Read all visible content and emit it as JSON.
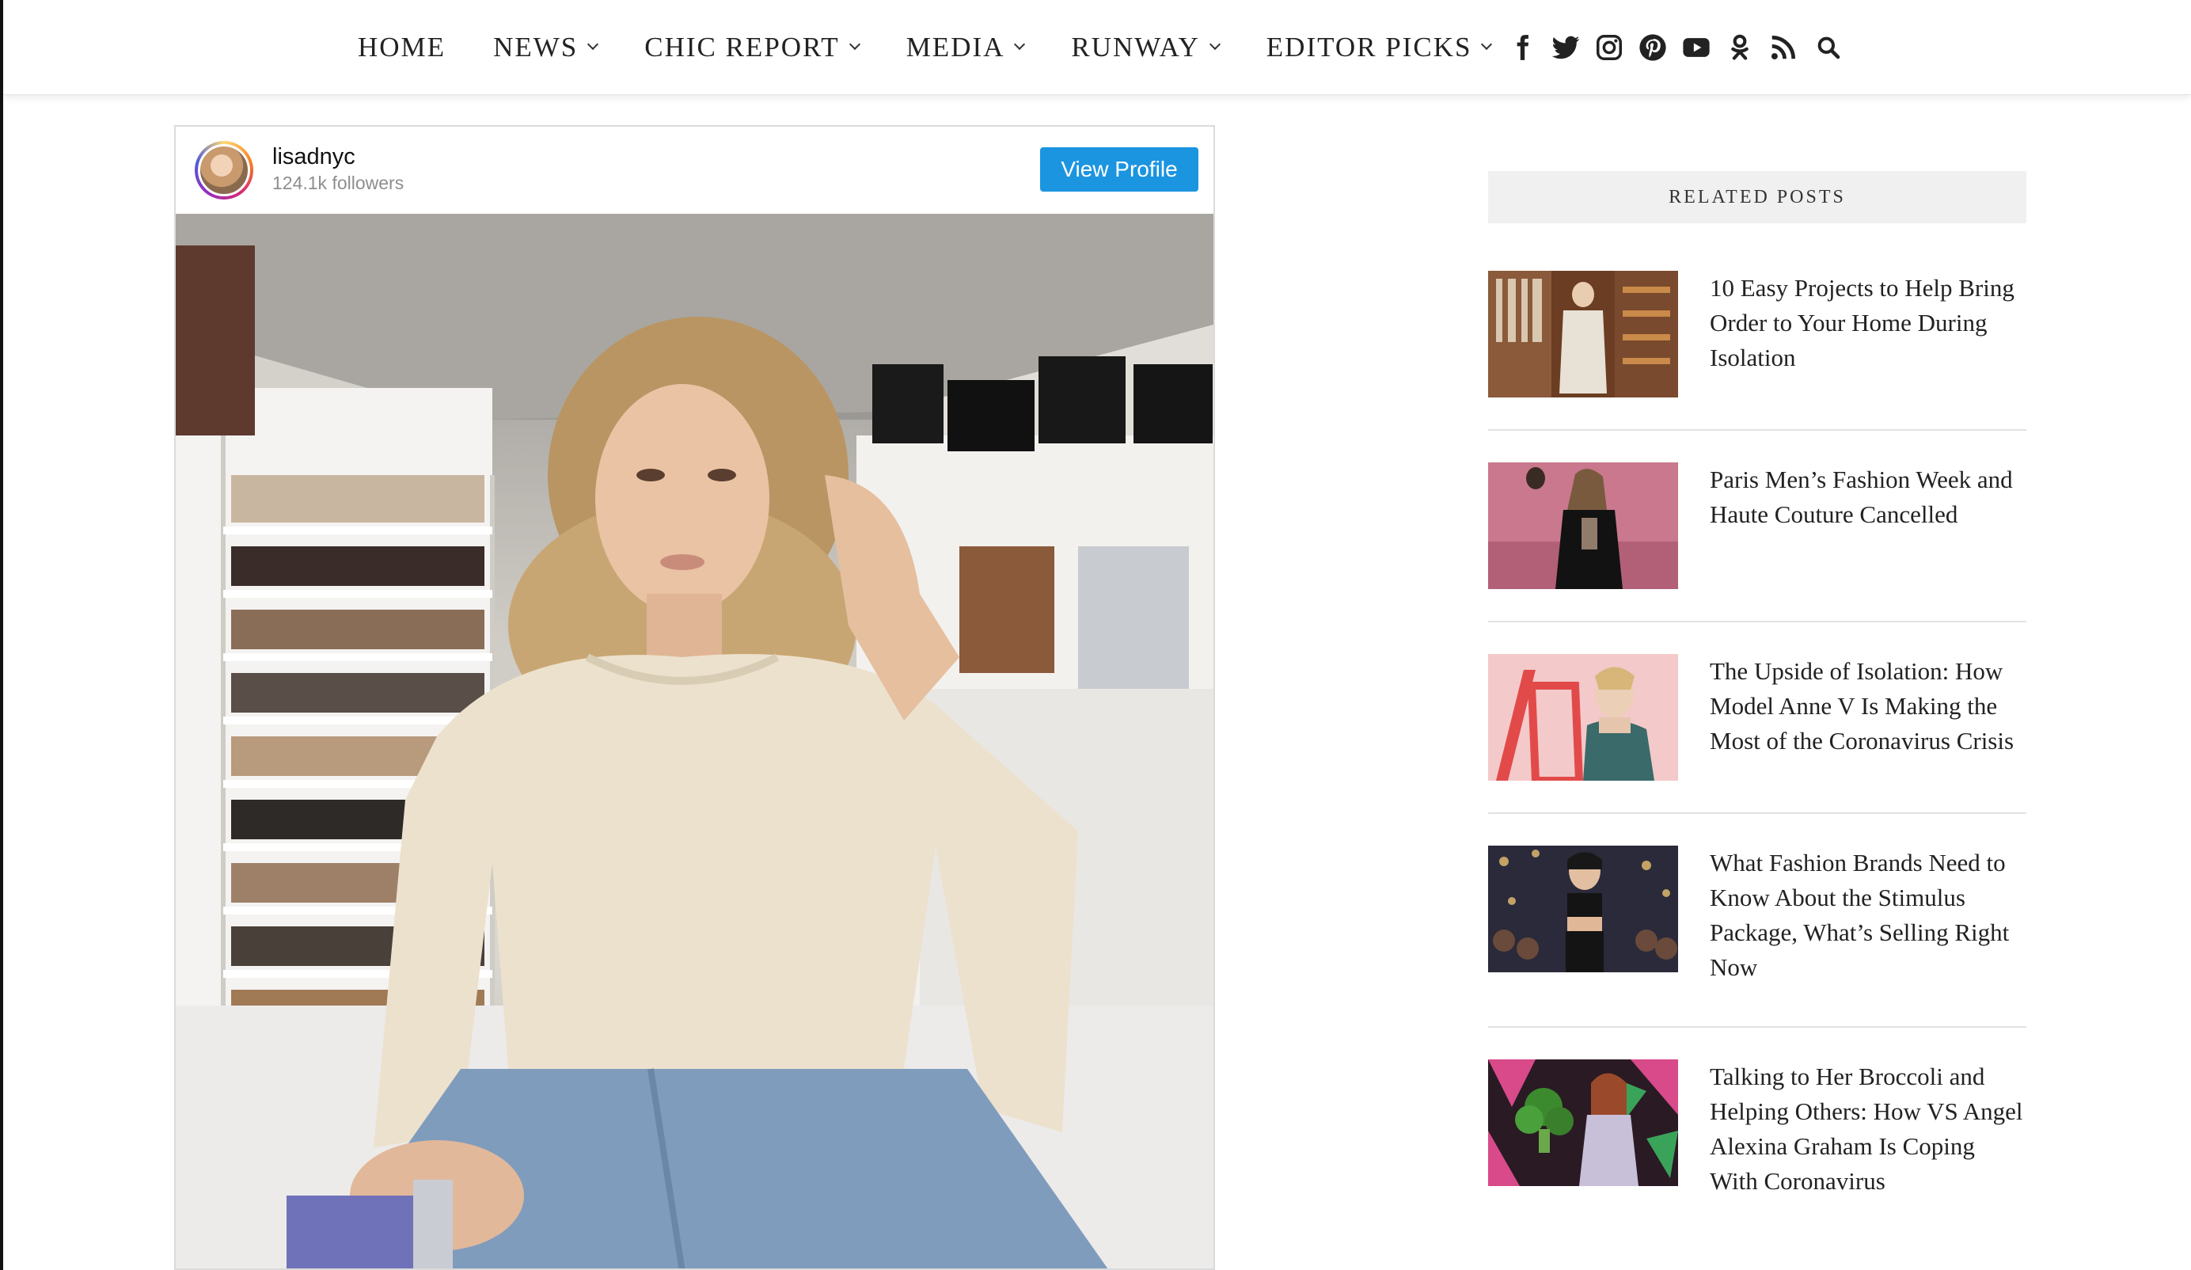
{
  "nav": {
    "items": [
      {
        "label": "HOME",
        "has_dropdown": false
      },
      {
        "label": "NEWS",
        "has_dropdown": true
      },
      {
        "label": "CHIC REPORT",
        "has_dropdown": true
      },
      {
        "label": "MEDIA",
        "has_dropdown": true
      },
      {
        "label": "RUNWAY",
        "has_dropdown": true
      },
      {
        "label": "EDITOR PICKS",
        "has_dropdown": true
      }
    ],
    "social_icons": [
      "facebook-icon",
      "twitter-icon",
      "instagram-icon",
      "pinterest-icon",
      "youtube-icon",
      "odnoklassniki-icon",
      "rss-icon"
    ],
    "search_icon": "search-icon"
  },
  "instagram": {
    "username": "lisadnyc",
    "followers": "124.1k followers",
    "view_profile_label": "View Profile",
    "button_color": "#1b95e0"
  },
  "sidebar": {
    "header": "RELATED POSTS",
    "posts": [
      {
        "title": "10 Easy Projects to Help Bring Order to Your Home During Isolation"
      },
      {
        "title": "Paris Men’s Fashion Week and Haute Couture Cancelled"
      },
      {
        "title": "The Upside of Isolation: How Model Anne V Is Making the Most of the Coronavirus Crisis"
      },
      {
        "title": "What Fashion Brands Need to Know About the Stimulus Package, What’s Selling Right Now"
      },
      {
        "title": "Talking to Her Broccoli and Helping Others: How VS Angel Alexina Graham Is Coping With Coronavirus"
      }
    ]
  }
}
